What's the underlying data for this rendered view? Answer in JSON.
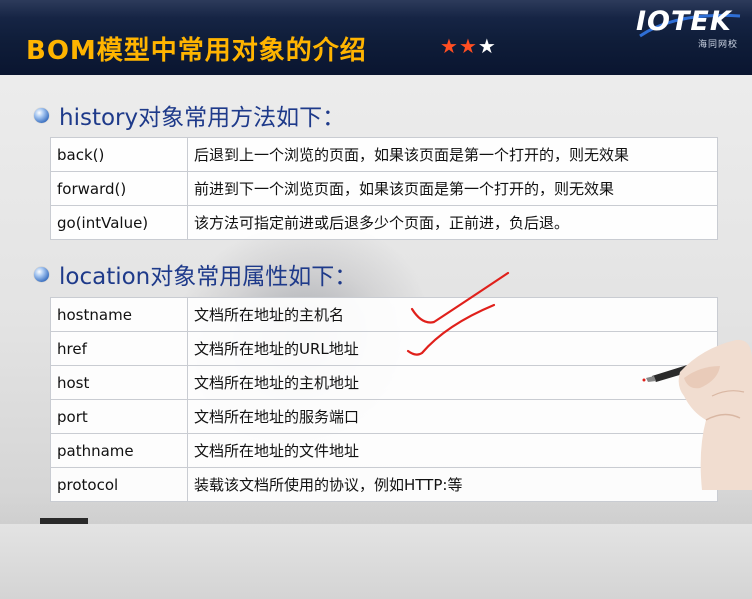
{
  "header": {
    "title": "BOM模型中常用对象的介绍",
    "stars": {
      "filled": 2,
      "total": 3
    },
    "logo": {
      "name": "IOTEK",
      "subtitle": "海同网校"
    }
  },
  "history_section": {
    "heading": "history对象常用方法如下：",
    "rows": [
      {
        "name": "back()",
        "desc": "后退到上一个浏览的页面，如果该页面是第一个打开的，则无效果"
      },
      {
        "name": "forward()",
        "desc": "前进到下一个浏览页面，如果该页面是第一个打开的，则无效果"
      },
      {
        "name": "go(intValue)",
        "desc": "该方法可指定前进或后退多少个页面，正前进，负后退。"
      }
    ]
  },
  "location_section": {
    "heading": "location对象常用属性如下：",
    "rows": [
      {
        "name": "hostname",
        "desc": "文档所在地址的主机名"
      },
      {
        "name": "href",
        "desc": "文档所在地址的URL地址"
      },
      {
        "name": "host",
        "desc": "文档所在地址的主机地址"
      },
      {
        "name": "port",
        "desc": "文档所在地址的服务端口"
      },
      {
        "name": "pathname",
        "desc": "文档所在地址的文件地址"
      },
      {
        "name": "protocol",
        "desc": "装载该文档所使用的协议，例如HTTP:等"
      }
    ]
  },
  "colors": {
    "title": "#ffb400",
    "heading": "#1e3a8a",
    "star_filled": "#ff4e22",
    "annotation": "#e0201b"
  }
}
